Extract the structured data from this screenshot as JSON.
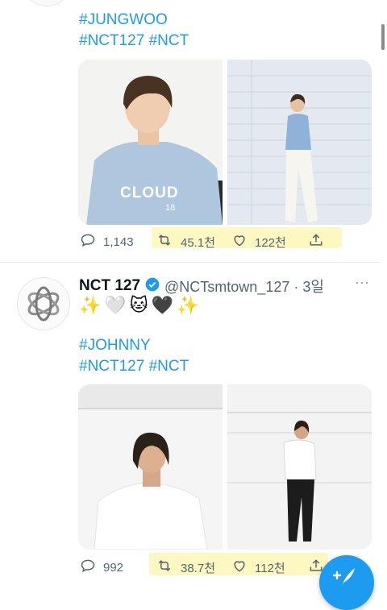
{
  "tweet1": {
    "hashtags": [
      "#JUNGWOO",
      "#NCT127 #NCT"
    ],
    "shirt_text": "CLOUD",
    "shirt_sub": "18",
    "reply_count": "1,143",
    "retweet_count": "45.1천",
    "like_count": "122천"
  },
  "tweet2": {
    "name": "NCT 127",
    "handle_time": "@NCTsmtown_127 · 3일",
    "more": "···",
    "emojis": "✨🤍🐱🖤✨",
    "hashtags": [
      "#JOHNNY",
      "#NCT127 #NCT"
    ],
    "reply_count": "992",
    "retweet_count": "38.7천",
    "like_count": "112천"
  },
  "colors": {
    "accent": "#1d9bf0",
    "highlight": "#fdf7b6",
    "text_secondary": "#536471"
  },
  "icons": [
    "reply-icon",
    "retweet-icon",
    "like-icon",
    "share-icon",
    "verified-icon",
    "compose-icon"
  ]
}
